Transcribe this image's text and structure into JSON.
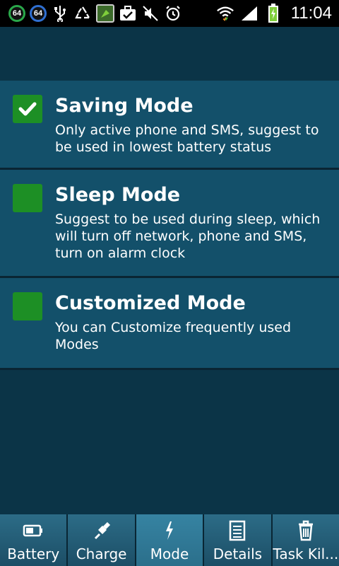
{
  "status_bar": {
    "badges": [
      "64",
      "64"
    ],
    "time": "11:04",
    "icons": [
      "usb-icon",
      "recycle-icon",
      "app-icon",
      "briefcase-check-icon",
      "mute-icon",
      "alarm-icon",
      "wifi-icon",
      "signal-icon",
      "battery-charging-icon"
    ]
  },
  "modes": [
    {
      "title": "Saving Mode",
      "description": "Only active phone and SMS, suggest to be used in lowest battery status",
      "checked": true
    },
    {
      "title": "Sleep Mode",
      "description": "Suggest to be used during sleep, which will turn off network, phone and SMS, turn on alarm clock",
      "checked": false
    },
    {
      "title": "Customized Mode",
      "description": "You can Customize frequently used Modes",
      "checked": false
    }
  ],
  "tabs": [
    {
      "label": "Battery",
      "icon": "battery-icon",
      "active": false
    },
    {
      "label": "Charge",
      "icon": "plug-icon",
      "active": false
    },
    {
      "label": "Mode",
      "icon": "lightning-icon",
      "active": true
    },
    {
      "label": "Details",
      "icon": "document-icon",
      "active": false
    },
    {
      "label": "Task Kil...",
      "icon": "trash-icon",
      "active": false
    }
  ],
  "colors": {
    "background": "#0b3447",
    "item_background": "#13506a",
    "checkbox_green": "#1d8f25",
    "tab_active": "#3683a2"
  }
}
